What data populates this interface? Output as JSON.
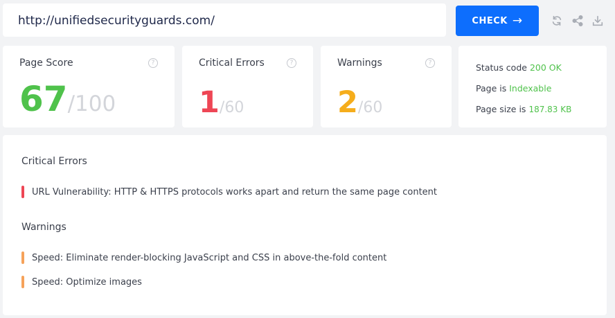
{
  "url": "http://unifiedsecurityguards.com/",
  "check_button": {
    "label": "CHECK",
    "icon": "arrow-right-icon"
  },
  "toolbar_icons": [
    "refresh-icon",
    "share-icon",
    "download-icon"
  ],
  "cards": {
    "page_score": {
      "title": "Page Score",
      "value": "67",
      "max": "/100",
      "color": "#4fc24b"
    },
    "critical_errors": {
      "title": "Critical Errors",
      "value": "1",
      "max": "/60",
      "color": "#ee4655"
    },
    "warnings": {
      "title": "Warnings",
      "value": "2",
      "max": "/60",
      "color": "#f5ad1c"
    },
    "help_icon": "?"
  },
  "status": {
    "status_code": {
      "label": "Status code",
      "value": "200 OK"
    },
    "page_is": {
      "label": "Page is",
      "value": "Indexable"
    },
    "page_size": {
      "label": "Page size is",
      "value": "187.83 KB"
    }
  },
  "issues": {
    "critical_title": "Critical Errors",
    "critical": [
      "URL Vulnerability: HTTP & HTTPS protocols works apart and return the same page content"
    ],
    "warnings_title": "Warnings",
    "warnings": [
      "Speed: Eliminate render-blocking JavaScript and CSS in above-the-fold content",
      "Speed: Optimize images"
    ]
  },
  "colors": {
    "accent": "#0d6efd",
    "critical_bar": "#ee4655",
    "warning_bar": "#f5a25a",
    "ok_green": "#4fc24b"
  }
}
